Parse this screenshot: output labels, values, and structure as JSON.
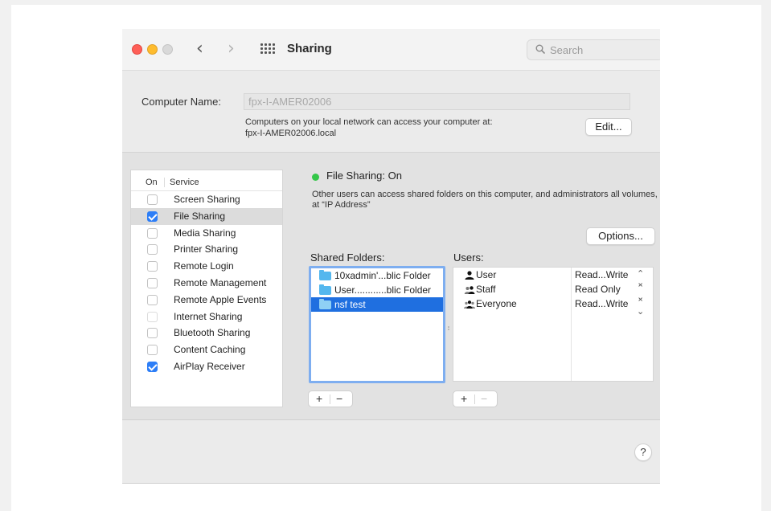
{
  "window": {
    "title": "Sharing"
  },
  "search": {
    "placeholder": "Search"
  },
  "computer_name": {
    "label": "Computer Name:",
    "value": "fpx-I-AMER02006",
    "info_line1": "Computers on your local network can access your computer at:",
    "info_line2": "fpx-I-AMER02006.local",
    "edit_label": "Edit..."
  },
  "services": {
    "header_on": "On",
    "header_service": "Service",
    "items": [
      {
        "label": "Screen Sharing",
        "checked": false
      },
      {
        "label": "File Sharing",
        "checked": true,
        "selected": true
      },
      {
        "label": "Media Sharing",
        "checked": false
      },
      {
        "label": "Printer Sharing",
        "checked": false
      },
      {
        "label": "Remote Login",
        "checked": false
      },
      {
        "label": "Remote Management",
        "checked": false
      },
      {
        "label": "Remote Apple Events",
        "checked": false
      },
      {
        "label": "Internet Sharing",
        "checked": false
      },
      {
        "label": "Bluetooth Sharing",
        "checked": false
      },
      {
        "label": "Content Caching",
        "checked": false
      },
      {
        "label": "AirPlay Receiver",
        "checked": true
      }
    ]
  },
  "status": {
    "text": "File Sharing: On",
    "color": "#34c749",
    "description": "Other users can access shared folders on this computer, and administrators all volumes, at “IP Address”"
  },
  "options_label": "Options...",
  "shared_folders": {
    "label": "Shared Folders:",
    "items": [
      {
        "label": "10xadmin'...blic Folder"
      },
      {
        "label": "User............blic Folder"
      },
      {
        "label": "nsf test",
        "selected": true
      }
    ]
  },
  "users": {
    "label": "Users:",
    "items": [
      {
        "label": "User",
        "icon": "single-user-icon",
        "permission": "Read...Write"
      },
      {
        "label": "Staff",
        "icon": "group-icon",
        "permission": "Read Only"
      },
      {
        "label": "Everyone",
        "icon": "everyone-icon",
        "permission": "Read...Write"
      }
    ]
  },
  "buttons": {
    "plus": "+",
    "minus": "−",
    "help": "?"
  },
  "colors": {
    "accent": "#2d7ef7",
    "selection": "#1f6fe0",
    "folder": "#54b7ee"
  }
}
